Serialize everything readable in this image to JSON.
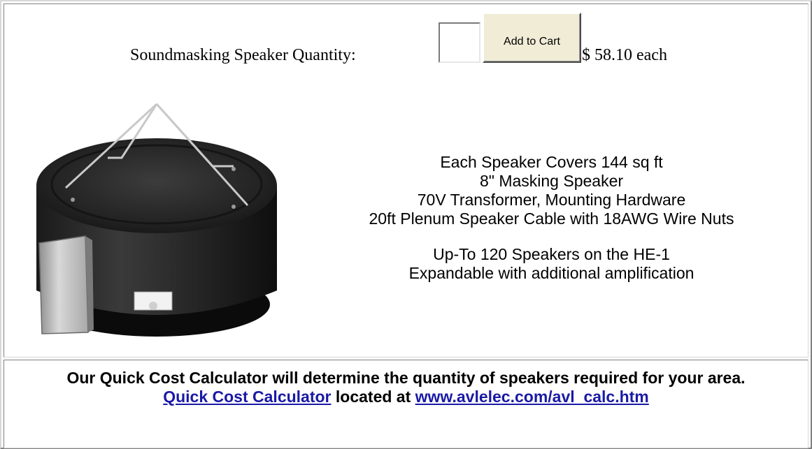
{
  "order": {
    "quantity_label": "Soundmasking Speaker Quantity:",
    "quantity_value": "",
    "add_to_cart_label": "Add to Cart",
    "price_text": "$ 58.10 each"
  },
  "product": {
    "image_name": "ceiling-speaker-photo",
    "features": [
      "Each Speaker Covers 144 sq ft",
      "8\" Masking Speaker",
      "70V Transformer, Mounting Hardware",
      "20ft Plenum Speaker Cable with 18AWG Wire Nuts"
    ],
    "capacity": [
      "Up-To 120 Speakers on the HE-1",
      "Expandable with additional amplification"
    ]
  },
  "calculator": {
    "description": "Our Quick Cost Calculator will determine the quantity of speakers required for your area.",
    "link_label": "Quick Cost Calculator",
    "located_at_text": "located at",
    "url_label": "www.avlelec.com/avl_calc.htm"
  },
  "colors": {
    "button_face": "#f1ecd6",
    "link": "#1a1aa6"
  }
}
